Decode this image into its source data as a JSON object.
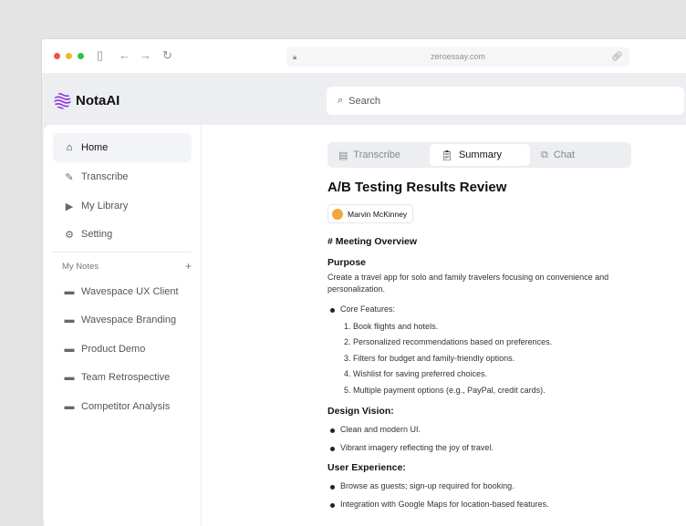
{
  "browser": {
    "url": "zeroessay.com"
  },
  "app": {
    "name": "NotaAI",
    "search_placeholder": "Search"
  },
  "sidebar": {
    "items": [
      {
        "label": "Home",
        "icon": "home-icon"
      },
      {
        "label": "Transcribe",
        "icon": "edit-icon"
      },
      {
        "label": "My Library",
        "icon": "library-icon"
      },
      {
        "label": "Setting",
        "icon": "gear-icon"
      }
    ],
    "notes_header": "My Notes",
    "add": "+",
    "notes": [
      "Wavespace UX Client",
      "Wavespace Branding",
      "Product Demo",
      "Team Retrospective",
      "Competitor Analysis"
    ]
  },
  "tabs": [
    "Transcribe",
    "Summary",
    "Chat"
  ],
  "doc": {
    "title": "A/B Testing Results Review",
    "author": "Marvin McKinney",
    "overview": "# Meeting Overview",
    "purpose_heading": "Purpose",
    "purpose": "Create a travel app for solo and family travelers focusing on convenience and personalization.",
    "core_label": "Core Features:",
    "core": [
      "1. Book flights and hotels.",
      "2. Personalized recommendations based on preferences.",
      "3. Filters for budget and family-friendly options.",
      "4. Wishlist for saving preferred choices.",
      "5. Multiple payment options (e.g., PayPal, credit cards)."
    ],
    "design_heading": "Design Vision:",
    "design": [
      "Clean and modern UI.",
      "Vibrant imagery reflecting the joy of travel."
    ],
    "ux_heading": "User Experience:",
    "ux": [
      "Browse as guests; sign-up required for booking.",
      "Integration with Google Maps for location-based features."
    ]
  }
}
